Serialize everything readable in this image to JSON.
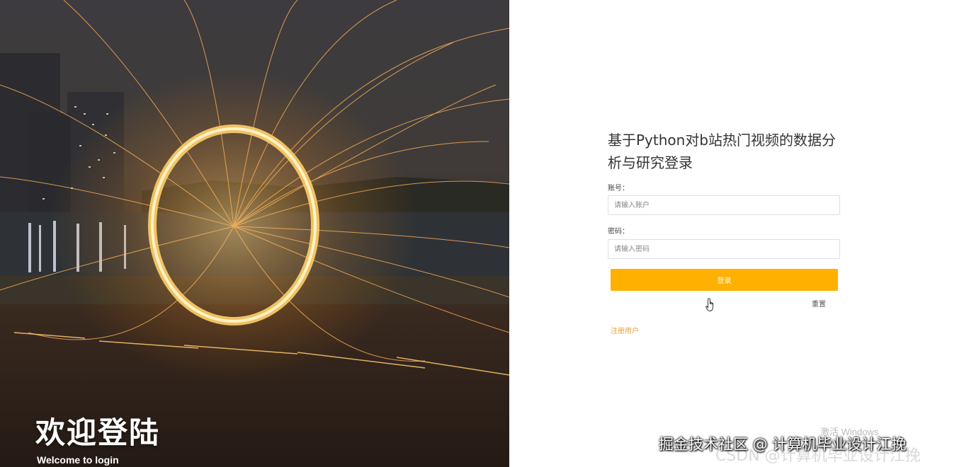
{
  "hero": {
    "title": "欢迎登陆",
    "subtitle": "Welcome to login"
  },
  "login": {
    "title": "基于Python对b站热门视频的数据分析与研究登录",
    "account_label": "账号：",
    "account_placeholder": "请输入账户",
    "password_label": "密码：",
    "password_placeholder": "请输入密码",
    "login_button": "登录",
    "reset_link": "重置",
    "register_link": "注册用户",
    "accent_color": "#ffb000"
  },
  "overlays": {
    "activate_windows": "激活 Windows",
    "watermark": "掘金技术社区 @ 计算机毕业设计江挽",
    "watermark_ghost": "CSDN @计算机毕业设计江挽"
  }
}
